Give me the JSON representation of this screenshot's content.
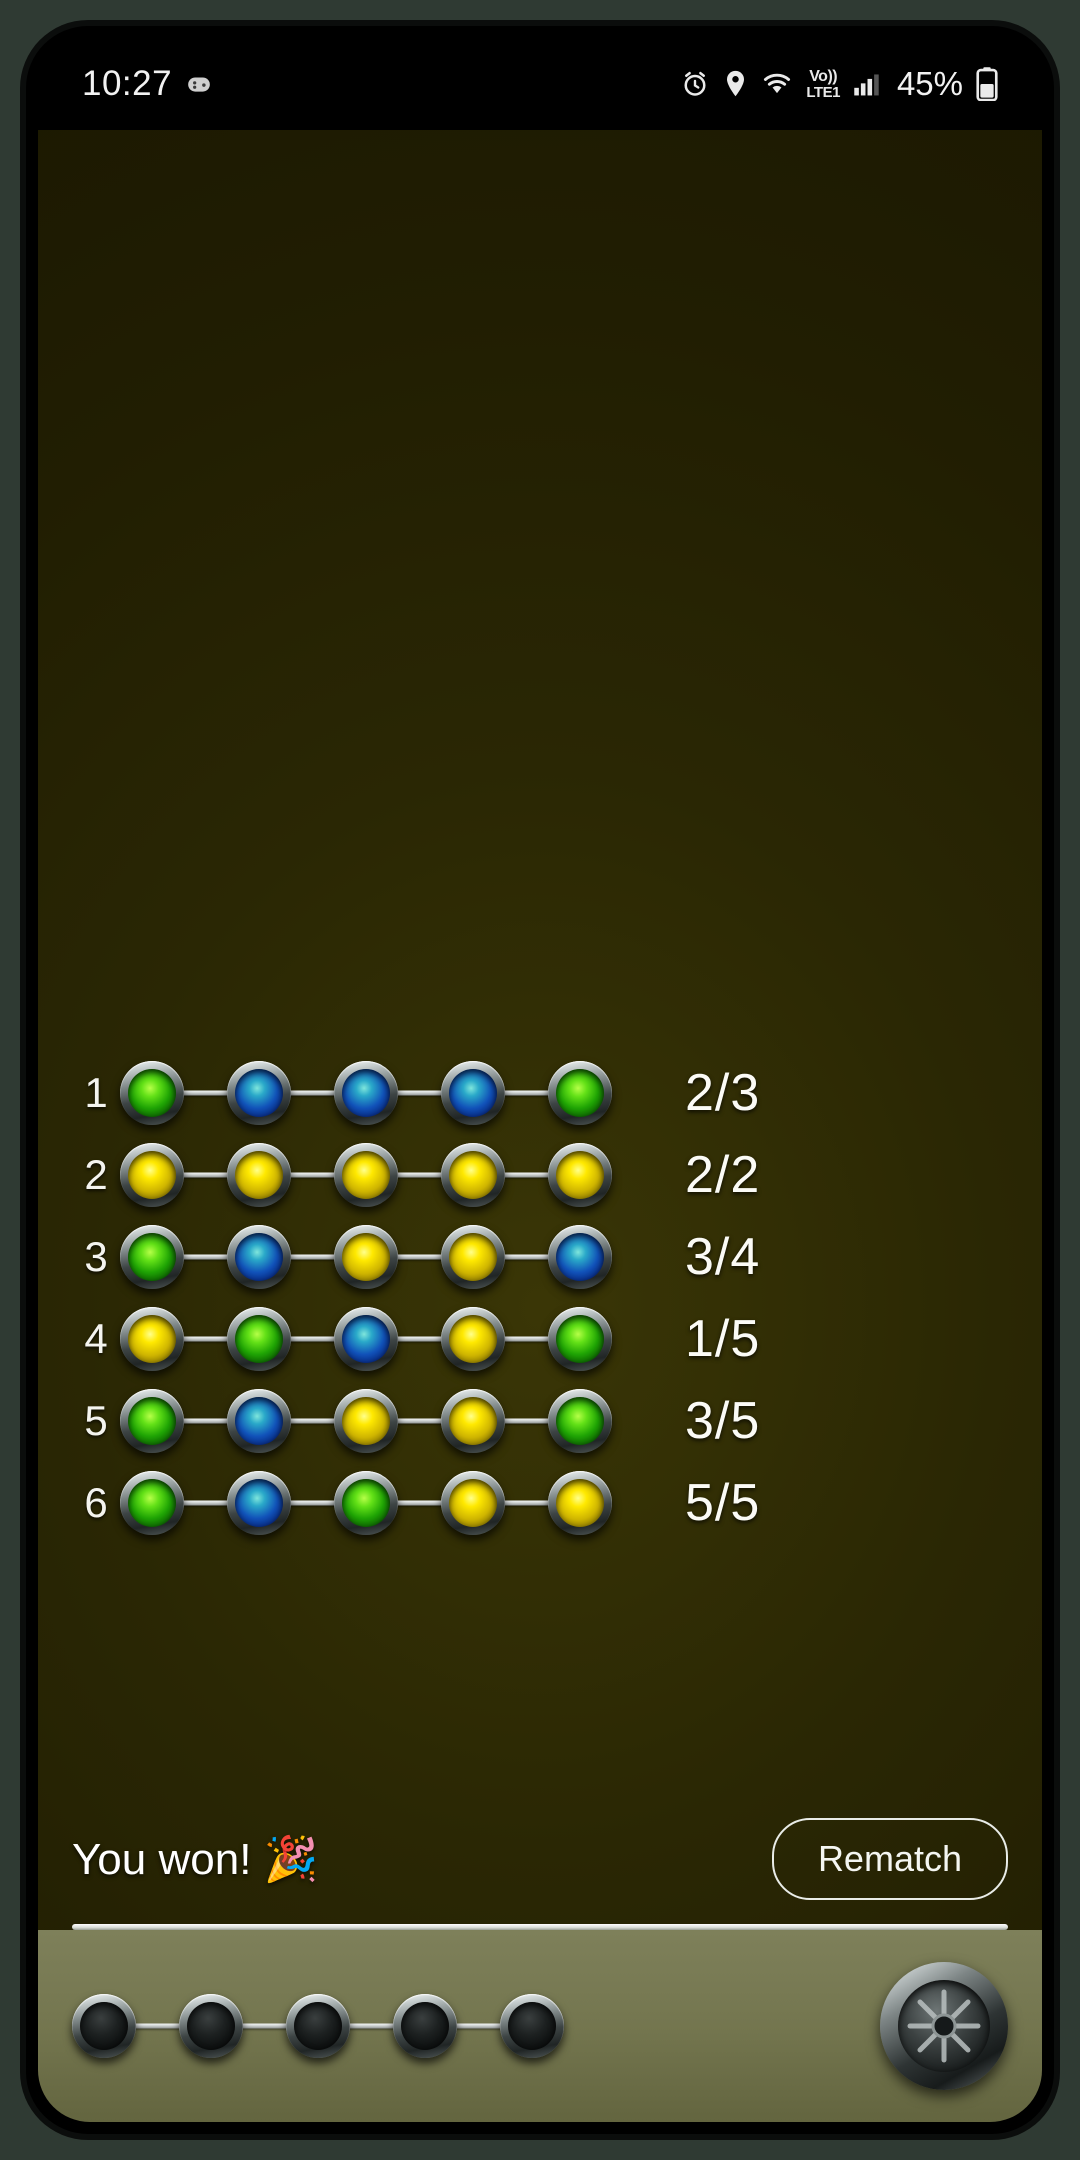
{
  "status_bar": {
    "time": "10:27",
    "battery_percent": "45%",
    "volte_top": "Vo))",
    "volte_bottom": "LTE1",
    "icons": [
      "game-controller-icon",
      "alarm-clock-icon",
      "location-pin-icon",
      "wifi-icon",
      "volte-icon",
      "cellular-signal-icon",
      "battery-icon"
    ]
  },
  "game": {
    "colors": {
      "green": "#3bd40a",
      "blue": "#1152b9",
      "yellow": "#ffe900",
      "background": "#2a2704",
      "tray": "#74764f"
    },
    "rows": [
      {
        "number": "1",
        "pegs": [
          "green",
          "blue",
          "blue",
          "blue",
          "green"
        ],
        "score": "2/3"
      },
      {
        "number": "2",
        "pegs": [
          "yellow",
          "yellow",
          "yellow",
          "yellow",
          "yellow"
        ],
        "score": "2/2"
      },
      {
        "number": "3",
        "pegs": [
          "green",
          "blue",
          "yellow",
          "yellow",
          "blue"
        ],
        "score": "3/4"
      },
      {
        "number": "4",
        "pegs": [
          "yellow",
          "green",
          "blue",
          "yellow",
          "green"
        ],
        "score": "1/5"
      },
      {
        "number": "5",
        "pegs": [
          "green",
          "blue",
          "yellow",
          "yellow",
          "green"
        ],
        "score": "3/5"
      },
      {
        "number": "6",
        "pegs": [
          "green",
          "blue",
          "green",
          "yellow",
          "yellow"
        ],
        "score": "5/5"
      }
    ],
    "result_text": "You won! 🎉",
    "rematch_label": "Rematch",
    "tray": {
      "pegs": [
        "empty",
        "empty",
        "empty",
        "empty",
        "empty"
      ],
      "knob_name": "submit-knob"
    }
  }
}
